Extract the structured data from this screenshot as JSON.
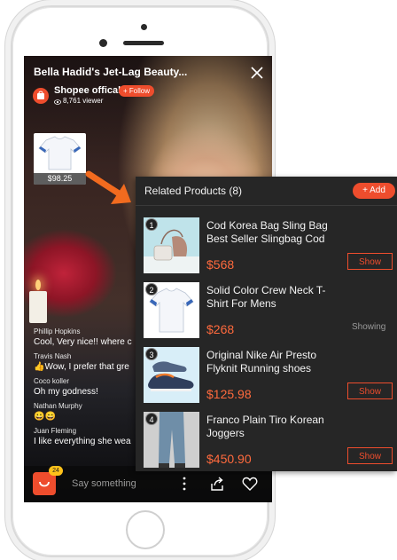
{
  "stream": {
    "title": "Bella Hadid's Jet-Lag Beauty...",
    "shop_name": "Shopee offical",
    "follow_label": "+ Follow",
    "viewers": "8,761 viewer",
    "pinned_price": "$98.25"
  },
  "comments": [
    {
      "name": "Phillip Hopkins",
      "text": "Cool, Very nice!! where c"
    },
    {
      "name": "Travis Nash",
      "text": "👍Wow, I prefer that gre"
    },
    {
      "name": "Coco koller",
      "text": "Oh my godness!"
    },
    {
      "name": "Nathan Murphy",
      "text": "😀😄"
    },
    {
      "name": "Juan Fleming",
      "text": "I like everything she wea"
    }
  ],
  "bottom_bar": {
    "bag_count": "24",
    "input_placeholder": "Say something",
    "icons": [
      "shopping-bag-icon",
      "more-vertical-icon",
      "share-icon",
      "heart-icon"
    ]
  },
  "panel": {
    "title": "Related Products (8)",
    "add_label": "+ Add",
    "products": [
      {
        "num": "1",
        "name": "Cod Korea Bag Sling Bag Best Seller Slingbag Cod",
        "price": "$568",
        "action": "Show"
      },
      {
        "num": "2",
        "name": "Solid Color Crew Neck T-Shirt For Mens",
        "price": "$268",
        "action": "Showing"
      },
      {
        "num": "3",
        "name": "Original Nike Air Presto Flyknit Running shoes",
        "price": "$125.98",
        "action": "Show"
      },
      {
        "num": "4",
        "name": "Franco Plain Tiro Korean Joggers",
        "price": "$450.90",
        "action": "Show"
      }
    ]
  },
  "colors": {
    "accent": "#ee4d2d",
    "price": "#ff6a3d",
    "panel_bg": "#262626",
    "arrow": "#f26b1f"
  }
}
